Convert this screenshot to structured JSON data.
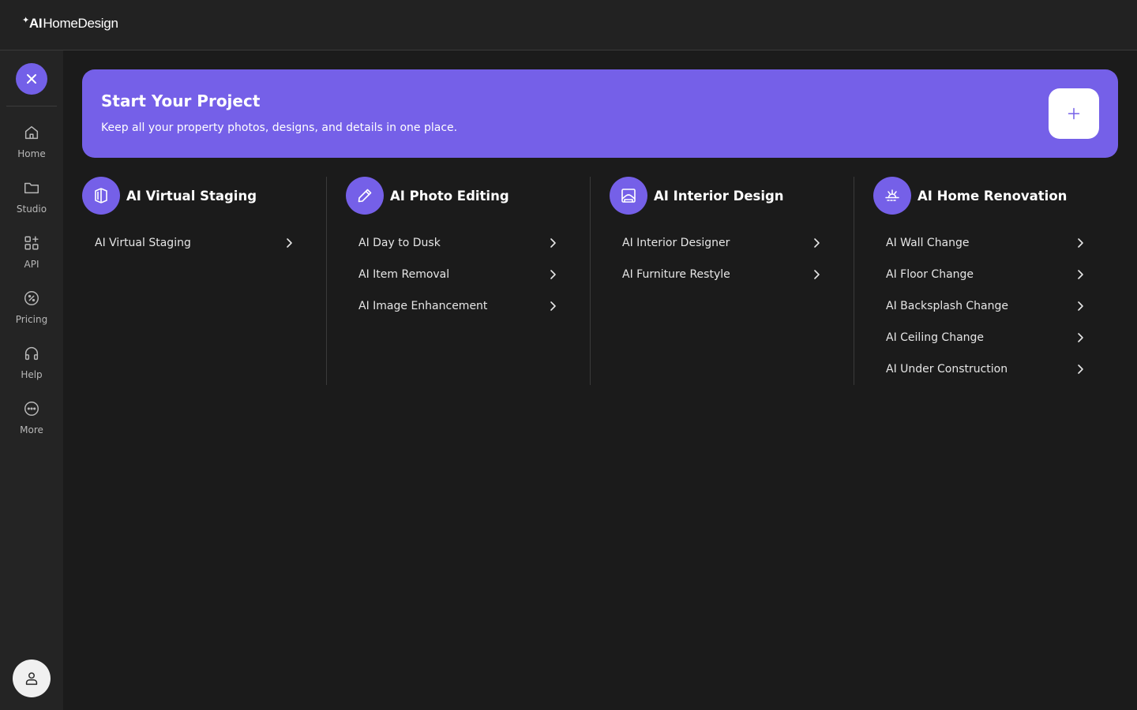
{
  "app": {
    "logo_ai": "AI",
    "logo_name": "HomeDesign"
  },
  "sidebar": {
    "items": [
      {
        "label": "Home",
        "icon": "home-icon"
      },
      {
        "label": "Studio",
        "icon": "folder-icon"
      },
      {
        "label": "API",
        "icon": "grid-plus-icon"
      },
      {
        "label": "Pricing",
        "icon": "percent-icon"
      },
      {
        "label": "Help",
        "icon": "headphones-icon"
      },
      {
        "label": "More",
        "icon": "more-dots-icon"
      }
    ]
  },
  "banner": {
    "title": "Start Your Project",
    "subtitle": "Keep all your property photos, designs, and details in one place."
  },
  "columns": [
    {
      "title": "AI Virtual Staging",
      "icon": "staging-icon",
      "items": [
        "AI Virtual Staging"
      ]
    },
    {
      "title": "AI Photo Editing",
      "icon": "pen-edit-icon",
      "items": [
        "AI Day to Dusk",
        "AI Item Removal",
        "AI Image Enhancement"
      ]
    },
    {
      "title": "AI Interior Design",
      "icon": "interior-icon",
      "items": [
        "AI Interior Designer",
        "AI Furniture Restyle"
      ]
    },
    {
      "title": "AI Home Renovation",
      "icon": "renovation-icon",
      "items": [
        "AI Wall Change",
        "AI Floor Change",
        "AI Backsplash Change",
        "AI Ceiling Change",
        "AI Under Construction"
      ]
    }
  ],
  "colors": {
    "accent": "#7560e8",
    "background": "#1b1b1b",
    "sidebar": "#242424"
  }
}
